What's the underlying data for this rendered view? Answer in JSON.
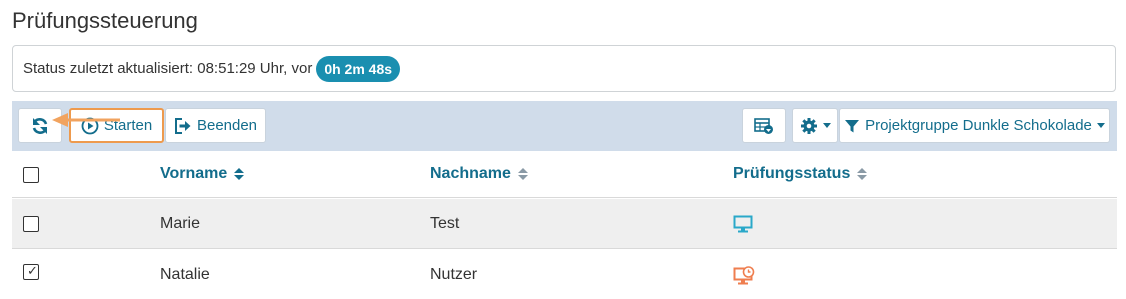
{
  "page": {
    "title": "Prüfungssteuerung"
  },
  "status": {
    "text": "Status zuletzt aktualisiert: 08:51:29 Uhr, vor",
    "elapsed": "0h 2m 48s"
  },
  "toolbar": {
    "start_label": "Starten",
    "end_label": "Beenden",
    "filter_label": "Projektgruppe Dunkle Schokolade",
    "highlight_color": "#ee9a4d"
  },
  "table": {
    "headers": {
      "firstname": "Vorname",
      "lastname": "Nachname",
      "status": "Prüfungsstatus"
    },
    "rows": [
      {
        "firstname": "Marie",
        "lastname": "Test",
        "status_icon": "monitor-icon",
        "status_color": "#2aa8c9",
        "checked": false
      },
      {
        "firstname": "Natalie",
        "lastname": "Nutzer",
        "status_icon": "monitor-clock-icon",
        "status_color": "#ef7e4f",
        "checked": true
      }
    ]
  },
  "colors": {
    "accent": "#136d8c",
    "badge": "#1a8fb0",
    "toolbar_bg": "#d0dcea",
    "arrow": "#f1a35f"
  }
}
